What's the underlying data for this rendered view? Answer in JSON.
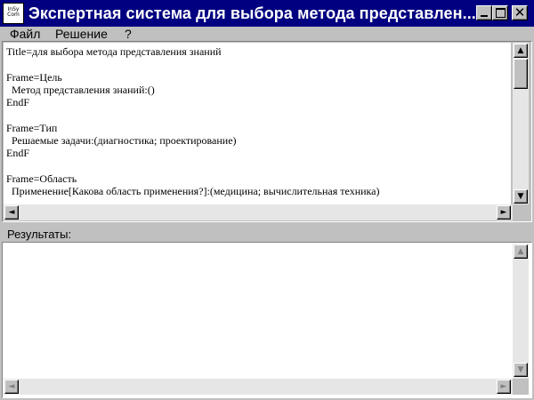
{
  "window": {
    "title": "Экспертная система для выбора метода представлен...",
    "icon_text": "InSy Com",
    "minimize_icon": "minimize-icon",
    "maximize_icon": "maximize-icon",
    "close_glyph": "✕"
  },
  "menu": [
    {
      "label": "Файл"
    },
    {
      "label": "Решение"
    },
    {
      "label": "?"
    }
  ],
  "editor": {
    "text": "Title=для выбора метода представления знаний\n\nFrame=Цель\n  Метод представления знаний:()\nEndF\n\nFrame=Тип\n  Решаемые задачи:(диагностика; проектирование)\nEndF\n\nFrame=Область\n  Применение[Какова область применения?]:(медицина; вычислительная техника)"
  },
  "results": {
    "label": "Результаты:",
    "text": ""
  },
  "scroll": {
    "up": "▲",
    "down": "▼",
    "left": "◄",
    "right": "►"
  },
  "colors": {
    "titlebar": "#000080",
    "face": "#c0c0c0"
  }
}
